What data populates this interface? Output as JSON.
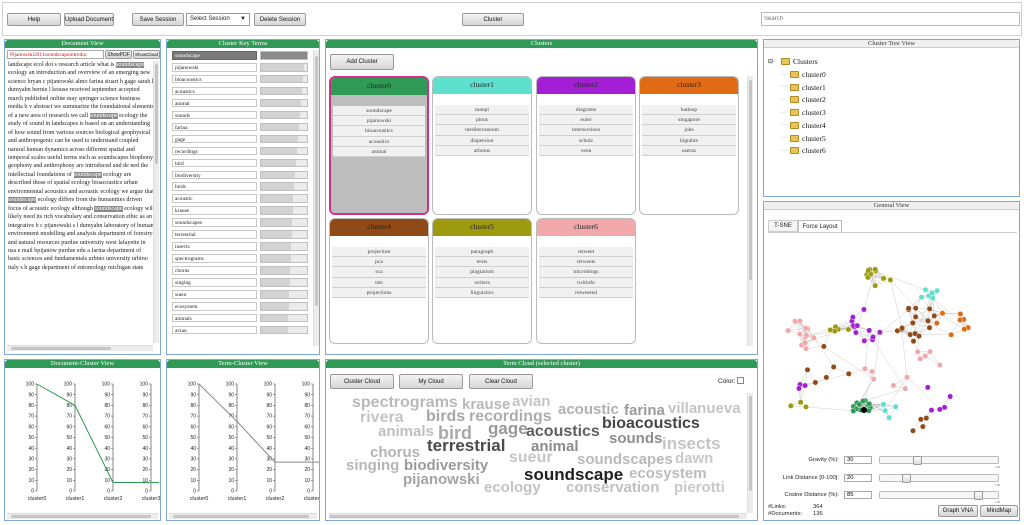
{
  "toolbar": {
    "help": "Help",
    "upload": "Upload Document",
    "save_session": "Save Session",
    "select_session": "Select Session",
    "delete_session": "Delete Session",
    "cluster": "Cluster",
    "search_placeholder": "Search"
  },
  "document_view": {
    "title": "Document View",
    "selected_file": "Pijanowski2011soundscapeintroduc",
    "show_pdf": "ShowPDF",
    "show_cloud": "ShowCloud",
    "text_segments": [
      {
        "t": "landscape ecol doi s research article what is ",
        "h": false
      },
      {
        "t": "soundscape",
        "h": true
      },
      {
        "t": " ecology an introduction and overview of an emerging new science bryan c pijanowski almo farina stuart h gage sarah l dumyahn bernie l krause received september accepted march published online may springer science business media b v abstract we summarize the foundational elements of a new area of research we call ",
        "h": false
      },
      {
        "t": "soundscape",
        "h": true
      },
      {
        "t": " ecology the study of sound in landscapes is based on an understanding of how sound from various sources biological geophysical and anthropogenic can be used to understand coupled natural human dynamics across different spatial and temporal scales useful terms such as soundscapes biophony geophony and anthrophony are introduced and de ned the intellectual foundations of ",
        "h": false
      },
      {
        "t": "soundscape",
        "h": true
      },
      {
        "t": " ecology are described those of spatial ecology bioacoustics urban environmental acoustics and acoustic ecology we argue that ",
        "h": false
      },
      {
        "t": "soundscape",
        "h": true
      },
      {
        "t": " ecology differs from the humanities driven focus of acoustic ecology although ",
        "h": false
      },
      {
        "t": "soundscape",
        "h": true
      },
      {
        "t": " ecology will likely need its rich vocabulary and conservation ethic as an integrative b c pijanowski s l dumyahn laboratory of human environment modelling and analysis department of forestry and natural resources purdue university west lafayette in usa e mail bpijanow purdue edu a farina department of basic sciences and fundamentals urbino university urbino italy s h gage department of entomology michigan state",
        "h": false
      }
    ]
  },
  "cluster_key_terms": {
    "title": "Cluster Key Terms",
    "terms": [
      {
        "label": "soundscape",
        "fill": 1.0,
        "selected": true
      },
      {
        "label": "pijanowski",
        "fill": 0.97,
        "selected": false
      },
      {
        "label": "bioacoustics",
        "fill": 0.96,
        "selected": false
      },
      {
        "label": "acoustics",
        "fill": 0.95,
        "selected": false
      },
      {
        "label": "animal",
        "fill": 0.94,
        "selected": false
      },
      {
        "label": "sounds",
        "fill": 0.93,
        "selected": false
      },
      {
        "label": "farina",
        "fill": 0.92,
        "selected": false
      },
      {
        "label": "gage",
        "fill": 0.91,
        "selected": false
      },
      {
        "label": "recordings",
        "fill": 0.9,
        "selected": false
      },
      {
        "label": "bird",
        "fill": 0.89,
        "selected": false
      },
      {
        "label": "biodiversity",
        "fill": 0.88,
        "selected": false
      },
      {
        "label": "birds",
        "fill": 0.87,
        "selected": false
      },
      {
        "label": "acoustic",
        "fill": 0.86,
        "selected": false
      },
      {
        "label": "krause",
        "fill": 0.86,
        "selected": false
      },
      {
        "label": "soundscapes",
        "fill": 0.85,
        "selected": false
      },
      {
        "label": "terrestrial",
        "fill": 0.85,
        "selected": false
      },
      {
        "label": "insects",
        "fill": 0.84,
        "selected": false
      },
      {
        "label": "spectrograms",
        "fill": 0.84,
        "selected": false
      },
      {
        "label": "chorus",
        "fill": 0.83,
        "selected": false
      },
      {
        "label": "singing",
        "fill": 0.83,
        "selected": false
      },
      {
        "label": "sueur",
        "fill": 0.82,
        "selected": false
      },
      {
        "label": "ecosystem",
        "fill": 0.82,
        "selected": false
      },
      {
        "label": "animals",
        "fill": 0.81,
        "selected": false
      },
      {
        "label": "avian",
        "fill": 0.81,
        "selected": false
      }
    ]
  },
  "clusters_panel": {
    "title": "Clusters",
    "add_cluster": "Add Cluster",
    "clusters": [
      {
        "name": "cluster0",
        "color": "#2f9a55",
        "selected": true,
        "terms": [
          "soundscape",
          "pijanowski",
          "bioacoustics",
          "acoustics",
          "animal"
        ]
      },
      {
        "name": "cluster1",
        "color": "#5ee0cf",
        "selected": false,
        "terms": [
          "maupi",
          "pinus",
          "mediterraneum",
          "dispersion",
          "arbutus"
        ]
      },
      {
        "name": "cluster2",
        "color": "#a31fd6",
        "selected": false,
        "terms": [
          "diagrams",
          "euler",
          "intersections",
          "schulz",
          "venn"
        ]
      },
      {
        "name": "cluster3",
        "color": "#e16b14",
        "selected": false,
        "terms": [
          "hadoop",
          "singapore",
          "jobs",
          "bigtable",
          "useraz"
        ]
      },
      {
        "name": "cluster4",
        "color": "#8f4a17",
        "selected": false,
        "terms": [
          "projection",
          "pca",
          "sca",
          "tsts",
          "projections"
        ]
      },
      {
        "name": "cluster5",
        "color": "#9d9a10",
        "selected": false,
        "terms": [
          "paragraph",
          "texts",
          "plagiarism",
          "writers",
          "linguistics"
        ]
      },
      {
        "name": "cluster6",
        "color": "#f0a8aa",
        "selected": false,
        "terms": [
          "retweet",
          "retweets",
          "microblogs",
          "twitinfo",
          "retweeted"
        ]
      }
    ]
  },
  "cluster_tree": {
    "title": "Cluster Tree View",
    "root": "Clusters",
    "children": [
      "cluster0",
      "cluster1",
      "cluster2",
      "cluster3",
      "cluster4",
      "cluster5",
      "cluster6"
    ]
  },
  "document_cluster_view": {
    "title": "Document-Cluster View",
    "axes": [
      "cluster0",
      "cluster1",
      "cluster2",
      "cluster3"
    ],
    "ticks": [
      "100",
      "90",
      "80",
      "70",
      "60",
      "50",
      "40",
      "30",
      "20",
      "10",
      "0"
    ],
    "line_color": "#2f9a55",
    "values": [
      100,
      80,
      8,
      8
    ]
  },
  "term_cluster_view": {
    "title": "Term-Cluster View",
    "axes": [
      "cluster0",
      "cluster1",
      "cluster2",
      "cluster3"
    ],
    "ticks": [
      "100",
      "90",
      "80",
      "70",
      "60",
      "50",
      "40",
      "30",
      "20",
      "10",
      "0"
    ],
    "line_color": "#888888",
    "values": [
      100,
      65,
      27,
      27
    ]
  },
  "term_cloud": {
    "title": "Term Cloud (selected cluster)",
    "cluster_cloud": "Cluster Cloud",
    "my_cloud": "My Cloud",
    "clear_cloud": "Clear Cloud",
    "color_label": "Color:",
    "words": [
      {
        "w": "spectrograms",
        "c": "#b9b9b9"
      },
      {
        "w": "krause",
        "c": "#b9b9b9"
      },
      {
        "w": "avian",
        "c": "#c4c4c4"
      },
      {
        "w": "acoustic",
        "c": "#b0b0b0"
      },
      {
        "w": "farina",
        "c": "#9a9a9a"
      },
      {
        "w": "villanueva",
        "c": "#c4c4c4"
      },
      {
        "w": "rivera",
        "c": "#c4c4c4"
      },
      {
        "w": "birds",
        "c": "#a6a6a6"
      },
      {
        "w": "recordings",
        "c": "#adadad"
      },
      {
        "w": "animals",
        "c": "#c0c0c0"
      },
      {
        "w": "bird",
        "c": "#a9a9a9"
      },
      {
        "w": "gage",
        "c": "#999999"
      },
      {
        "w": "acoustics",
        "c": "#5f5f5f"
      },
      {
        "w": "bioacoustics",
        "c": "#454545"
      },
      {
        "w": "sounds",
        "c": "#8d8d8d"
      },
      {
        "w": "terrestrial",
        "c": "#4a4a4a"
      },
      {
        "w": "animal",
        "c": "#8a8a8a"
      },
      {
        "w": "insects",
        "c": "#c4c4c4"
      },
      {
        "w": "chorus",
        "c": "#b3b3b3"
      },
      {
        "w": "sueur",
        "c": "#c6c6c6"
      },
      {
        "w": "soundscapes",
        "c": "#b9b9b9"
      },
      {
        "w": "dawn",
        "c": "#c8c8c8"
      },
      {
        "w": "singing",
        "c": "#b6b6b6"
      },
      {
        "w": "biodiversity",
        "c": "#9a9a9a"
      },
      {
        "w": "soundscape",
        "c": "#1f1f1f"
      },
      {
        "w": "ecosystem",
        "c": "#bcbcbc"
      },
      {
        "w": "pijanowski",
        "c": "#a4a4a4"
      },
      {
        "w": "ecology",
        "c": "#c2c2c2"
      },
      {
        "w": "conservation",
        "c": "#c0c0c0"
      },
      {
        "w": "pierotti",
        "c": "#c8c8c8"
      }
    ]
  },
  "general_view": {
    "title": "General View",
    "tabs": [
      "T-SNE",
      "Force Layout"
    ],
    "active_tab": "Force Layout",
    "gravity_label": "Gravity (%):",
    "gravity_value": "30",
    "gravity_fraction": 0.3,
    "link_distance_label": "Link Distance [0-100]:",
    "link_distance_value": "20",
    "link_distance_fraction": 0.2,
    "cosine_distance_label": "Cosine Distance (%):",
    "cosine_distance_value": "85",
    "cosine_distance_fraction": 0.85,
    "slider_max": "100",
    "links_label": "#Links:",
    "links_value": "364",
    "documents_label": "#Documents:",
    "documents_value": "136",
    "graph_vna": "Graph VNA",
    "mindmap": "MindMap"
  }
}
